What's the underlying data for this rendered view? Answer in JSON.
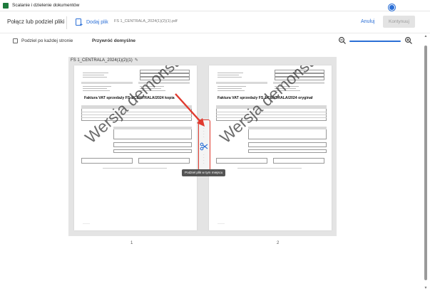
{
  "window": {
    "title": "Scalanie i dzielenie dokumentów"
  },
  "header": {
    "title": "Połącz lub podziel pliki",
    "add_file_label": "Dodaj plik",
    "file_name": "FS 1_CENTRALA_2024(1)(2)(1).pdf",
    "cancel_label": "Anuluj",
    "continue_label": "Kontynuuj"
  },
  "toolbar": {
    "split_each_page_label": "Podziel po każdej stronie",
    "restore_defaults_label": "Przywróć domyślne",
    "split_each_page_checked": false,
    "zoom_level_fraction": 0.82
  },
  "document": {
    "title": "FS 1_CENTRALA_2024(1)(2)(1)",
    "pages": [
      {
        "number": "1",
        "heading": "Faktura VAT sprzedaży FS 1/CENTRALA/2024 kopia",
        "watermark": "Wersja demonstracyjna"
      },
      {
        "number": "2",
        "heading": "Faktura VAT sprzedaży FS 1/CENTRALA/2024 oryginał",
        "watermark": "Wersja demonstracyjna"
      }
    ],
    "split_tooltip": "Podziel plik w tym miejscu"
  },
  "icons": {
    "app": "app-icon",
    "add": "add-file-icon",
    "zoom_out": "zoom-out-icon",
    "zoom_in": "zoom-in-icon",
    "edit": "pencil-icon",
    "split": "scissors-icon"
  },
  "colors": {
    "accent": "#2b6fd6",
    "highlight": "#e03a2f"
  }
}
